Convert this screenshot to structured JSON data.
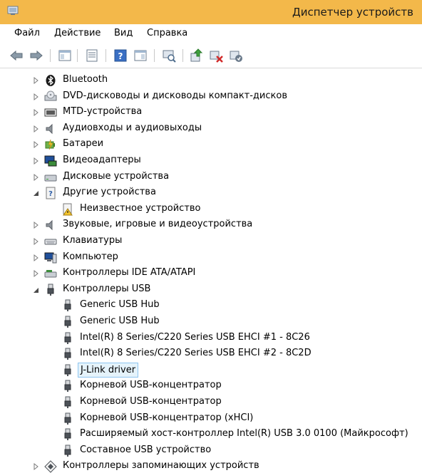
{
  "window": {
    "title": "Диспетчер устройств",
    "app_icon": "device-manager-icon"
  },
  "menu": [
    "Файл",
    "Действие",
    "Вид",
    "Справка"
  ],
  "toolbar": {
    "buttons": [
      "back-icon",
      "forward-icon",
      "show-hide-tree-icon",
      "properties-icon",
      "help-icon",
      "show-hide-action-pane-icon",
      "scan-hardware-icon",
      "update-driver-icon",
      "disable-device-icon",
      "uninstall-device-icon"
    ]
  },
  "tree": {
    "nodes": [
      {
        "label": "Bluetooth",
        "icon": "bluetooth-icon",
        "expanded": false,
        "level": 0
      },
      {
        "label": "DVD-дисководы и дисководы компакт-дисков",
        "icon": "dvd-drive-icon",
        "expanded": false,
        "level": 0
      },
      {
        "label": "MTD-устройства",
        "icon": "mtd-device-icon",
        "expanded": false,
        "level": 0
      },
      {
        "label": "Аудиовходы и аудиовыходы",
        "icon": "speaker-icon",
        "expanded": false,
        "level": 0
      },
      {
        "label": "Батареи",
        "icon": "battery-icon",
        "expanded": false,
        "level": 0
      },
      {
        "label": "Видеоадаптеры",
        "icon": "display-adapter-icon",
        "expanded": false,
        "level": 0
      },
      {
        "label": "Дисковые устройства",
        "icon": "disk-drive-icon",
        "expanded": false,
        "level": 0
      },
      {
        "label": "Другие устройства",
        "icon": "unknown-device-icon",
        "expanded": true,
        "level": 0
      },
      {
        "label": "Неизвестное устройство",
        "icon": "warning-device-icon",
        "level": 1
      },
      {
        "label": "Звуковые, игровые и видеоустройства",
        "icon": "speaker-icon",
        "expanded": false,
        "level": 0
      },
      {
        "label": "Клавиатуры",
        "icon": "keyboard-icon",
        "expanded": false,
        "level": 0
      },
      {
        "label": "Компьютер",
        "icon": "computer-icon",
        "expanded": false,
        "level": 0
      },
      {
        "label": "Контроллеры IDE ATA/ATAPI",
        "icon": "ide-controller-icon",
        "expanded": false,
        "level": 0
      },
      {
        "label": "Контроллеры USB",
        "icon": "usb-plug-icon",
        "expanded": true,
        "level": 0
      },
      {
        "label": "Generic USB Hub",
        "icon": "usb-plug-icon",
        "level": 1
      },
      {
        "label": "Generic USB Hub",
        "icon": "usb-plug-icon",
        "level": 1
      },
      {
        "label": "Intel(R) 8 Series/C220 Series USB EHCI #1 - 8C26",
        "icon": "usb-plug-icon",
        "level": 1
      },
      {
        "label": "Intel(R) 8 Series/C220 Series USB EHCI #2 - 8C2D",
        "icon": "usb-plug-icon",
        "level": 1
      },
      {
        "label": "J-Link driver",
        "icon": "usb-plug-icon",
        "level": 1,
        "selected": true
      },
      {
        "label": "Корневой USB-концентратор",
        "icon": "usb-plug-icon",
        "level": 1
      },
      {
        "label": "Корневой USB-концентратор",
        "icon": "usb-plug-icon",
        "level": 1
      },
      {
        "label": "Корневой USB-концентратор (xHCI)",
        "icon": "usb-plug-icon",
        "level": 1
      },
      {
        "label": "Расширяемый хост-контроллер Intel(R) USB 3.0 0100 (Майкрософт)",
        "icon": "usb-plug-icon",
        "level": 1
      },
      {
        "label": "Составное USB устройство",
        "icon": "usb-plug-icon",
        "level": 1
      },
      {
        "label": "Контроллеры запоминающих устройств",
        "icon": "storage-controller-icon",
        "expanded": false,
        "level": 0
      }
    ]
  },
  "colors": {
    "titlebar": "#f3b84a",
    "selection_border": "#8ec5f0",
    "selection_fill": "#e5f3fb"
  }
}
